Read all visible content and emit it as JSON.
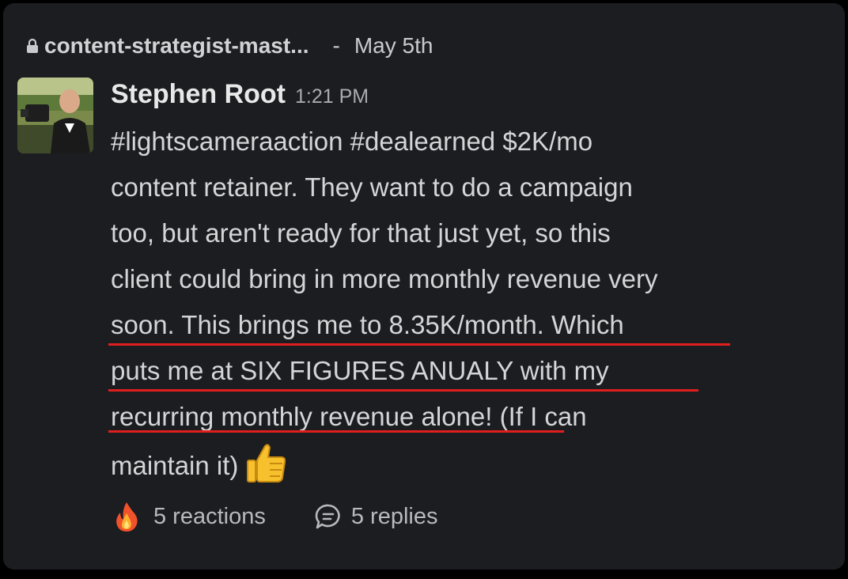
{
  "channel": {
    "name": "content-strategist-mast...",
    "separator": "-",
    "date": "May 5th",
    "lock_icon": "lock-icon"
  },
  "message": {
    "author": "Stephen Root",
    "time": "1:21 PM",
    "lines": [
      "#lightscameraaction #dealearned $2K/mo",
      "content retainer. They want to do a campaign",
      "too, but aren't ready for that just yet, so this",
      "client could bring in more monthly revenue very",
      "soon. This brings me to 8.35K/month. Which",
      "puts me at SIX FIGURES ANUALY with my",
      "recurring monthly revenue alone! (If I can",
      "maintain it)"
    ],
    "end_emoji": "thumbs-up-icon",
    "highlight_color": "#e01e1e"
  },
  "footer": {
    "reactions_icon": "fire-icon",
    "reactions_label": "5 reactions",
    "replies_icon": "reply-bubble-icon",
    "replies_label": "5 replies"
  },
  "colors": {
    "background": "#1b1d21",
    "text": "#d4d5d6",
    "muted": "#a9abad",
    "underline": "#e01e1e"
  }
}
